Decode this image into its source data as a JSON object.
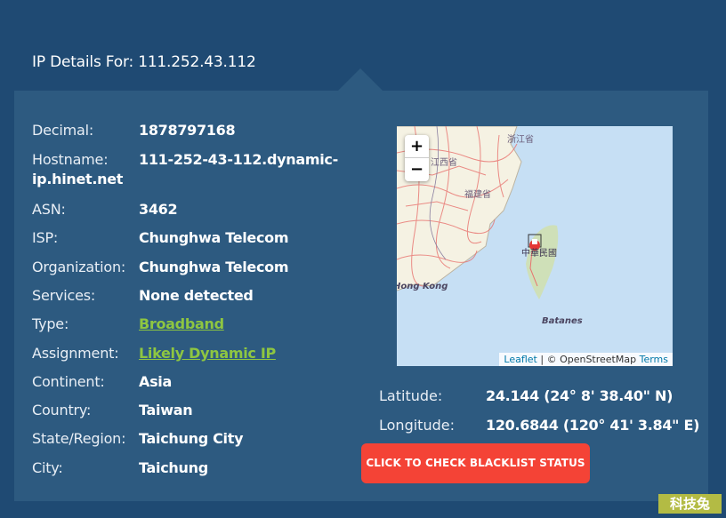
{
  "header": {
    "title": "IP Details For: 111.252.43.112"
  },
  "details": [
    {
      "label": "Decimal:",
      "value": "1878797168"
    },
    {
      "label": "Hostname:",
      "value": "111-252-43-112.dynamic-",
      "value_cont": "ip.hinet.net"
    },
    {
      "label": "ASN:",
      "value": "3462"
    },
    {
      "label": "ISP:",
      "value": "Chunghwa Telecom"
    },
    {
      "label": "Organization:",
      "value": "Chunghwa Telecom"
    },
    {
      "label": "Services:",
      "value": "None detected"
    },
    {
      "label": "Type:",
      "value": "Broadband",
      "link": true
    },
    {
      "label": "Assignment:",
      "value": "Likely Dynamic IP",
      "link": true
    },
    {
      "label": "Continent:",
      "value": "Asia"
    },
    {
      "label": "Country:",
      "value": "Taiwan"
    },
    {
      "label": "State/Region:",
      "value": "Taichung City"
    },
    {
      "label": "City:",
      "value": "Taichung"
    }
  ],
  "map": {
    "zoom_in": "+",
    "zoom_out": "−",
    "labels": {
      "zhejiang": "浙江省",
      "jiangxi": "江西省",
      "fujian": "福建省",
      "taiwan": "中華民國",
      "hongkong": "Hong Kong",
      "batanes": "Batanes"
    },
    "attribution": {
      "leaflet": "Leaflet",
      "separator": " | © OpenStreetMap ",
      "terms": "Terms"
    },
    "colors": {
      "water": "#c6dff4",
      "land": "#f5f2e3",
      "roads": "#e8716d",
      "marker": "#e53935"
    }
  },
  "coordinates": {
    "latitude": {
      "label": "Latitude:",
      "value": "24.144  (24° 8' 38.40\" N)"
    },
    "longitude": {
      "label": "Longitude:",
      "value": "120.6844  (120° 41' 3.84\" E)"
    }
  },
  "actions": {
    "blacklist_button": "CLICK TO CHECK BLACKLIST STATUS"
  },
  "watermark": "科技兔",
  "colors": {
    "background": "#1f4a73",
    "panel": "#2d5a80",
    "link": "#8ec641",
    "button": "#f44336"
  }
}
